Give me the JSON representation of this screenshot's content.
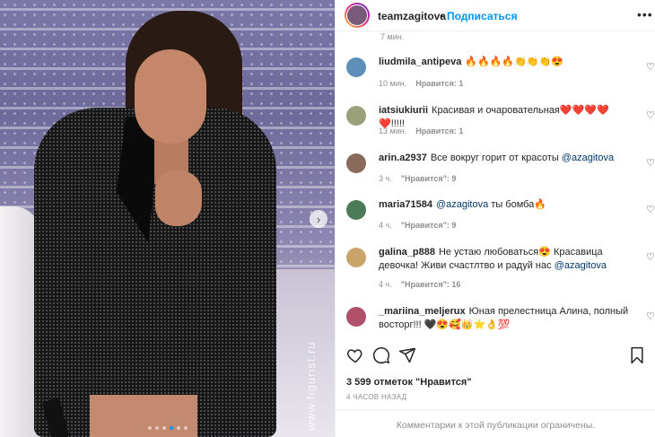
{
  "post": {
    "username": "teamzagitova",
    "follow_label": "Подписаться",
    "separator": "•",
    "more_icon": "•••",
    "watermark": "www.figurist.ru",
    "carousel": {
      "count": 6,
      "active_index": 3
    },
    "truncated_time": "7 мин."
  },
  "comments": [
    {
      "user": "liudmila_antipeva",
      "text": "🔥🔥🔥🔥👏👏👏😍",
      "time": "10 мин.",
      "likes": "Нравится: 1",
      "avatar_color": "#5d8fb8"
    },
    {
      "user": "iatsiukiurii",
      "text": "Красивая и очаровательная❤️❤️❤️❤️❤️!!!!!",
      "time": "13 мин.",
      "likes": "Нравится: 1",
      "avatar_color": "#9aa07a"
    },
    {
      "user": "arin.a2937",
      "text": "Все вокруг горит от красоты",
      "mention": "@azagitova",
      "time": "3 ч.",
      "likes": "\"Нравится\": 9",
      "avatar_color": "#8a6a5a"
    },
    {
      "user": "maria71584",
      "mention": "@azagitova",
      "text": "ты бомба🔥",
      "time": "4 ч.",
      "likes": "\"Нравится\": 9",
      "avatar_color": "#4d7a58"
    },
    {
      "user": "galina_p888",
      "text": "Не устаю любоваться😍 Красавица девочка! Живи счастлтво и радуй нас",
      "mention": "@azagitova",
      "time": "4 ч.",
      "likes": "\"Нравится\": 16",
      "avatar_color": "#c9a46a"
    },
    {
      "user": "_mariina_meljerux",
      "text": "Юная прелестница Алина, полный восторг!!! 🖤😍🥰👑⭐👌💯",
      "avatar_color": "#b0506a"
    }
  ],
  "footer": {
    "likes_text": "3 599 отметок \"Нравится\"",
    "time_ago": "4 ЧАСОВ НАЗАД",
    "restricted_text": "Комментарии к этой публикации ограничены."
  },
  "icons": {
    "like": "heart-outline-icon",
    "comment": "comment-icon",
    "share": "paper-plane-icon",
    "save": "bookmark-icon",
    "like_symbol": "♡"
  },
  "colors": {
    "link": "#0095f6",
    "mention": "#00376b",
    "muted": "#8e8e8e"
  }
}
